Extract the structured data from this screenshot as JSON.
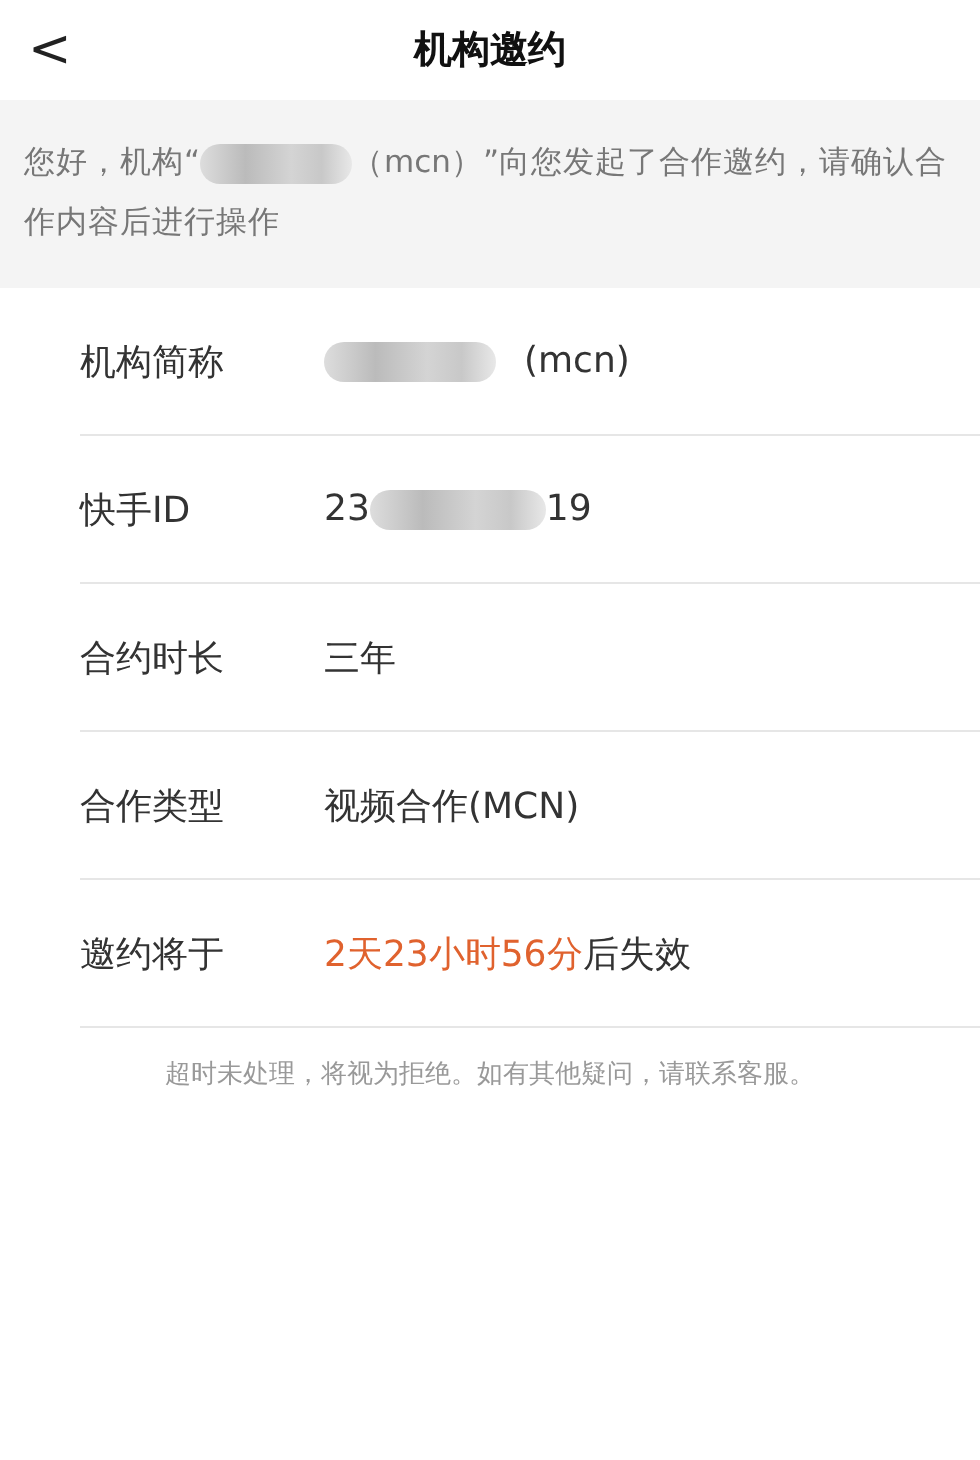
{
  "header": {
    "back": "<",
    "title": "机构邀约"
  },
  "notice": {
    "parts": [
      {
        "kind": "text",
        "text": "您好，机构“"
      },
      {
        "kind": "redacted"
      },
      {
        "kind": "text",
        "text": "（mcn）”向您发起了合作邀约，请确认合作内容后进行操作"
      }
    ]
  },
  "rows": [
    {
      "label": "机构简称",
      "parts": [
        {
          "kind": "redacted"
        },
        {
          "kind": "text",
          "text": "(mcn)"
        }
      ]
    },
    {
      "label": "快手ID",
      "parts": [
        {
          "kind": "text",
          "text": "23"
        },
        {
          "kind": "redacted"
        },
        {
          "kind": "text",
          "text": "19"
        }
      ]
    },
    {
      "label": "合约时长",
      "parts": [
        {
          "kind": "text",
          "text": "三年"
        }
      ]
    },
    {
      "label": "合作类型",
      "parts": [
        {
          "kind": "text",
          "text": "视频合作(MCN)"
        }
      ]
    },
    {
      "label": "邀约将于",
      "parts": [
        {
          "kind": "highlight",
          "text": "2天23小时56分"
        },
        {
          "kind": "text",
          "text": "后失效"
        }
      ]
    }
  ],
  "footnote": "超时未处理，将视为拒绝。如有其他疑问，请联系客服。"
}
